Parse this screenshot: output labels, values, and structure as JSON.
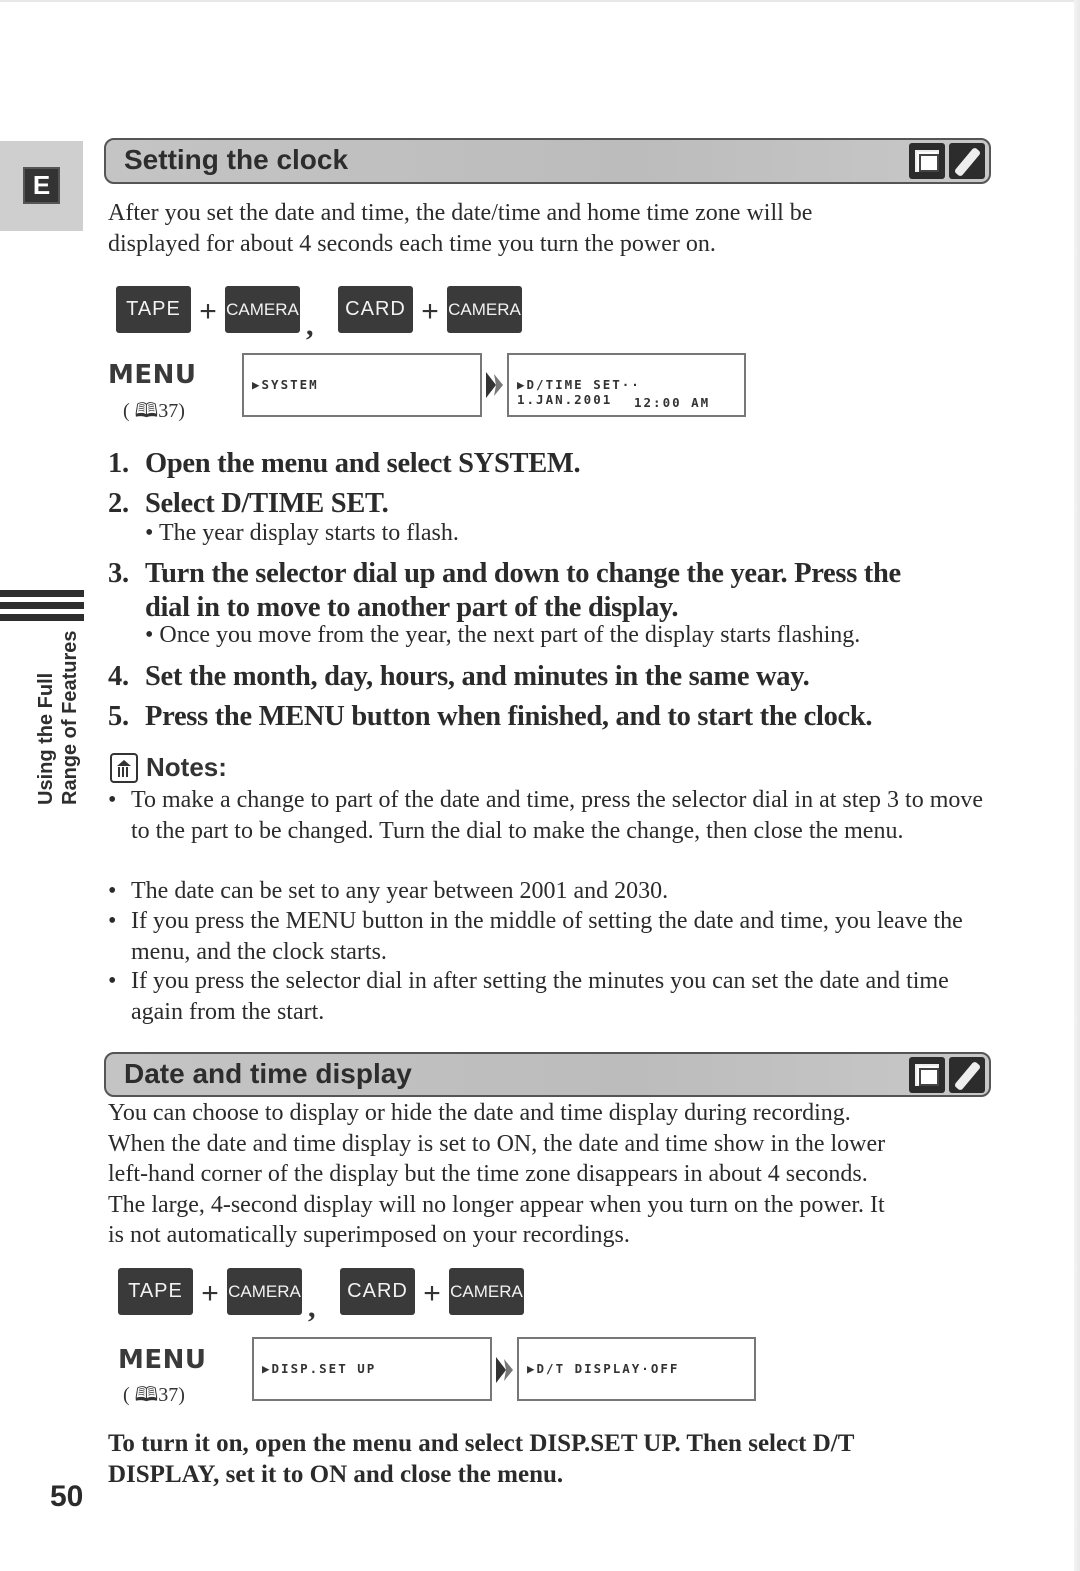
{
  "language_tab": {
    "letter": "E"
  },
  "chapter_tab": {
    "line1": "Using the Full",
    "line2": "Range of Features"
  },
  "section1": {
    "title": "Setting the clock",
    "icons": [
      "memory-card-icon",
      "pen-icon"
    ],
    "intro_line1": "After you set the date and time, the date/time and home time zone will be",
    "intro_line2": "displayed for about 4 seconds each time you turn the power on.",
    "modes": {
      "tape": "TAPE",
      "camera": "CAMERA",
      "card": "CAMERA_CARD",
      "plus": "+",
      "comma": ","
    },
    "menu": {
      "label": "MENU",
      "ref": "( 🕮37)",
      "ref_page": "37",
      "screen1": "▶SYSTEM",
      "screen2_line1": "▶D/TIME SET·· 1.JAN.2001",
      "screen2_line2": "12:00 AM"
    },
    "steps": [
      {
        "num": "1.",
        "text": "Open the menu and select SYSTEM."
      },
      {
        "num": "2.",
        "text": "Select D/TIME SET.",
        "sub": "• The year display starts to flash."
      },
      {
        "num": "3.",
        "line1": "Turn the selector dial up and down to change the year. Press the",
        "line2": "dial in to move to another part of the display.",
        "sub": "• Once you move from the year, the next part of the display starts flashing."
      },
      {
        "num": "4.",
        "text": "Set the month, day, hours, and minutes in the same way."
      },
      {
        "num": "5.",
        "text": "Press the MENU button when finished, and to start the clock."
      }
    ],
    "notes_title": "Notes:",
    "notes": [
      {
        "bullet": "•",
        "text": "To make a change to part of the date and time, press the selector dial in at step 3 to move to the part to be changed. Turn the dial to make the change, then close the menu."
      },
      {
        "bullet": "•",
        "text": "The date can be set to any year between 2001 and 2030."
      },
      {
        "bullet": "•",
        "text": "If you press the MENU button in the middle of setting the date and time, you leave the menu, and the clock starts."
      },
      {
        "bullet": "•",
        "text": "If you press the selector dial in after setting the minutes you can set the date and time again from the start."
      }
    ]
  },
  "section2": {
    "title": "Date and time display",
    "intro": [
      "You can choose to display or hide the date and time display during recording.",
      "When the date and time display is set to ON, the date and time show in the lower",
      "left-hand corner of the display but the time zone disappears in about 4 seconds.",
      "The large, 4-second display will no longer appear when you turn on the power. It",
      "is not automatically superimposed on your recordings."
    ],
    "menu": {
      "label": "MENU",
      "ref_page": "37",
      "screen1": "▶DISP.SET UP",
      "screen2": "▶D/T DISPLAY·OFF"
    },
    "final_line1": "To turn it on, open the menu and select DISP.SET UP. Then select D/T",
    "final_line2": "DISPLAY, set it to ON and close the menu."
  },
  "labels": {
    "tape": "TAPE",
    "card": "CARD",
    "camera": "CAMERA",
    "plus": "+",
    "comma": ",",
    "ref_open": "(",
    "ref_close": ")"
  },
  "page_number": "50"
}
